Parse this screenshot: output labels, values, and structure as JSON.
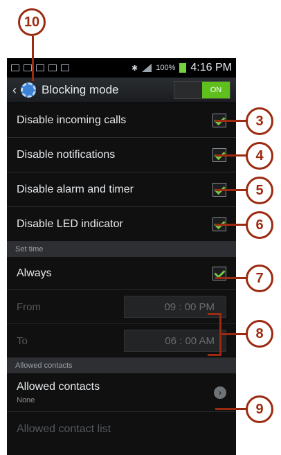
{
  "status_bar": {
    "time": "4:16 PM",
    "battery": "100%"
  },
  "action_bar": {
    "title": "Blocking mode",
    "toggle": "ON"
  },
  "callouts": {
    "c10": "10",
    "c3": "3",
    "c4": "4",
    "c5": "5",
    "c6": "6",
    "c7": "7",
    "c8": "8",
    "c9": "9"
  },
  "settings": {
    "incoming_calls": "Disable incoming calls",
    "notifications": "Disable notifications",
    "alarm_timer": "Disable alarm and timer",
    "led": "Disable LED indicator"
  },
  "set_time": {
    "header": "Set time",
    "always": "Always",
    "from_label": "From",
    "from_value": "09 : 00 PM",
    "to_label": "To",
    "to_value": "06 : 00 AM"
  },
  "contacts": {
    "header": "Allowed contacts",
    "title": "Allowed contacts",
    "value": "None",
    "list": "Allowed contact list"
  }
}
